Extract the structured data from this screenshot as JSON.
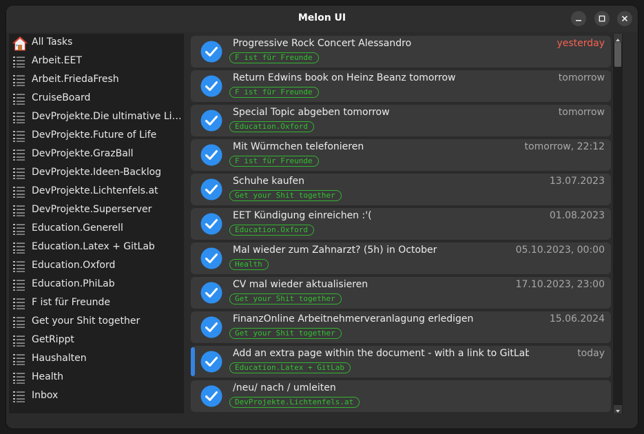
{
  "window": {
    "title": "Melon UI",
    "controls": [
      "minimize-icon",
      "maximize-icon",
      "close-icon"
    ]
  },
  "sidebar": {
    "items": [
      {
        "label": "All Tasks",
        "icon": "home-icon"
      },
      {
        "label": "Arbeit.EET",
        "icon": "list-icon"
      },
      {
        "label": "Arbeit.FriedaFresh",
        "icon": "list-icon"
      },
      {
        "label": "CruiseBoard",
        "icon": "list-icon"
      },
      {
        "label": "DevProjekte.Die ultimative Lin…",
        "icon": "list-icon"
      },
      {
        "label": "DevProjekte.Future of Life",
        "icon": "list-icon"
      },
      {
        "label": "DevProjekte.GrazBall",
        "icon": "list-icon"
      },
      {
        "label": "DevProjekte.Ideen-Backlog",
        "icon": "list-icon"
      },
      {
        "label": "DevProjekte.Lichtenfels.at",
        "icon": "list-icon"
      },
      {
        "label": "DevProjekte.Superserver",
        "icon": "list-icon"
      },
      {
        "label": "Education.Generell",
        "icon": "list-icon"
      },
      {
        "label": "Education.Latex + GitLab",
        "icon": "list-icon"
      },
      {
        "label": "Education.Oxford",
        "icon": "list-icon"
      },
      {
        "label": "Education.PhiLab",
        "icon": "list-icon"
      },
      {
        "label": "F ist für Freunde",
        "icon": "list-icon"
      },
      {
        "label": "Get your Shit together",
        "icon": "list-icon"
      },
      {
        "label": "GetRippt",
        "icon": "list-icon"
      },
      {
        "label": "Haushalten",
        "icon": "list-icon"
      },
      {
        "label": "Health",
        "icon": "list-icon"
      },
      {
        "label": "Inbox",
        "icon": "list-icon"
      }
    ]
  },
  "tasks": [
    {
      "title": "Progressive Rock Concert Alessandro",
      "date": "yesterday",
      "overdue": true,
      "tag": "F ist für Freunde"
    },
    {
      "title": "Return Edwins book on Heinz Beanz tomorrow",
      "date": "tomorrow",
      "overdue": false,
      "tag": "F ist für Freunde"
    },
    {
      "title": "Special Topic abgeben tomorrow",
      "date": "tomorrow",
      "overdue": false,
      "tag": "Education.Oxford"
    },
    {
      "title": "Mit Würmchen telefonieren",
      "date": "tomorrow, 22:12",
      "overdue": false,
      "tag": "F ist für Freunde"
    },
    {
      "title": "Schuhe kaufen",
      "date": "13.07.2023",
      "overdue": false,
      "tag": "Get your Shit together"
    },
    {
      "title": "EET Kündigung einreichen :'(",
      "date": "01.08.2023",
      "overdue": false,
      "tag": "Education.Oxford"
    },
    {
      "title": "Mal wieder zum Zahnarzt? (5h) in October",
      "date": "05.10.2023, 00:00",
      "overdue": false,
      "tag": "Health"
    },
    {
      "title": "CV mal wieder aktualisieren",
      "date": "17.10.2023, 23:00",
      "overdue": false,
      "tag": "Get your Shit together"
    },
    {
      "title": "FinanzOnline Arbeitnehmerveranlagung erledigen",
      "date": "15.06.2024",
      "overdue": false,
      "tag": "Get your Shit together"
    },
    {
      "title": "Add an extra page within the document - with a link to GitLab!",
      "date": "today",
      "overdue": false,
      "tag": "Education.Latex + GitLab",
      "selected": true
    },
    {
      "title": "/neu/ nach / umleiten",
      "date": "",
      "overdue": false,
      "tag": "DevProjekte.Lichtenfels.at"
    }
  ],
  "colors": {
    "accent": "#3584e4",
    "overdue": "#f66151",
    "tag": "#33c030",
    "checkbox": "#2e8ff0"
  }
}
